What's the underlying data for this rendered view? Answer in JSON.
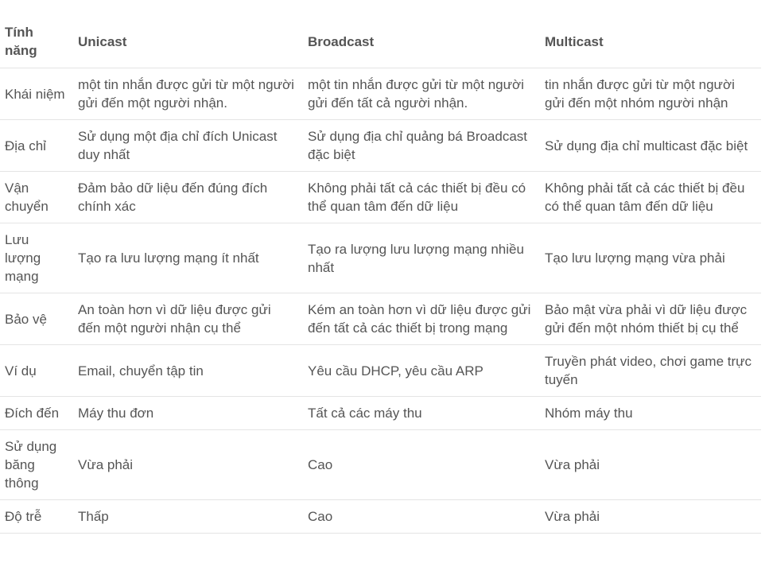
{
  "table": {
    "headers": [
      "Tính năng",
      "Unicast",
      "Broadcast",
      "Multicast"
    ],
    "rows": [
      [
        "Khái niệm",
        "một tin nhắn được gửi từ một người gửi đến một người nhận.",
        "một tin nhắn được gửi từ một người gửi đến tất cả người nhận.",
        "tin nhắn được gửi từ một người gửi đến một nhóm người nhận"
      ],
      [
        "Địa chỉ",
        "Sử dụng một địa chỉ đích Unicast duy nhất",
        "Sử dụng địa chỉ quảng bá Broadcast đặc biệt",
        "Sử dụng địa chỉ multicast đặc biệt"
      ],
      [
        "Vận chuyển",
        "Đảm bảo dữ liệu đến đúng đích chính xác",
        "Không phải tất cả các thiết bị đều có thể quan tâm đến dữ liệu",
        "Không phải tất cả các thiết bị đều có thể quan tâm đến dữ liệu"
      ],
      [
        "Lưu lượng mạng",
        "Tạo ra lưu lượng mạng ít nhất",
        "Tạo ra lượng lưu lượng mạng nhiều nhất",
        "Tạo lưu lượng mạng vừa phải"
      ],
      [
        "Bảo vệ",
        "An toàn hơn vì dữ liệu được gửi đến một người nhận cụ thể",
        "Kém an toàn hơn vì dữ liệu được gửi đến tất cả các thiết bị trong mạng",
        "Bảo mật vừa phải vì dữ liệu được gửi đến một nhóm thiết bị cụ thể"
      ],
      [
        "Ví dụ",
        "Email, chuyển tập tin",
        "Yêu cầu DHCP, yêu cầu ARP",
        "Truyền phát video, chơi game trực tuyến"
      ],
      [
        "Đích đến",
        "Máy thu đơn",
        "Tất cả các máy thu",
        "Nhóm máy thu"
      ],
      [
        "Sử dụng băng thông",
        "Vừa phải",
        "Cao",
        "Vừa phải"
      ],
      [
        "Độ trễ",
        "Thấp",
        "Cao",
        "Vừa phải"
      ]
    ]
  }
}
